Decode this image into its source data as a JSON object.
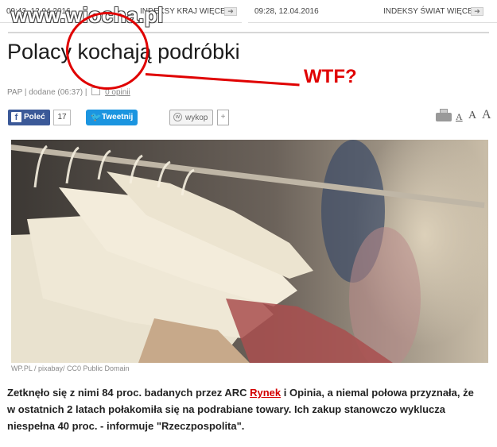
{
  "topbar": {
    "logo": "www.wiocha.pl",
    "left": {
      "time": "09:43, 12.04.2016",
      "more": "INDEKSY KRAJ WIĘCEJ"
    },
    "right": {
      "time": "09:28, 12.04.2016",
      "more": "INDEKSY ŚWIAT WIĘCEJ"
    }
  },
  "article": {
    "title": "Polacy kochają podróbki",
    "meta": {
      "source": "PAP",
      "added": "dodane (06:37)",
      "comments": "0 opinii"
    },
    "annotation": "WTF?",
    "social": {
      "fb_label": "Poleć",
      "fb_count": "17",
      "tweet_label": "Tweetnij",
      "wykop_label": "wykop",
      "wykop_plus": "+"
    },
    "font_sizes": [
      "A",
      "A",
      "A"
    ],
    "photo_caption": "WP.PL / pixabay/ CC0 Public Domain",
    "body": {
      "part1": "Zetknęło się z nimi 84 proc. badanych przez ARC ",
      "link": "Rynek",
      "part2": " i Opinia, a niemal połowa przyznała, że w ostatnich 2 latach połakomiła się na podrabiane towary. Ich zakup stanowczo wyklucza niespełna 40 proc. - informuje \"Rzeczpospolita\"."
    }
  },
  "colors": {
    "accent_red": "#e00000",
    "facebook": "#3b5998",
    "twitter": "#1b95e0",
    "link": "#d40000"
  },
  "icons": [
    "facebook-icon",
    "twitter-bird-icon",
    "wykop-icon",
    "printer-icon",
    "comment-icon",
    "arrow-right-icon"
  ]
}
